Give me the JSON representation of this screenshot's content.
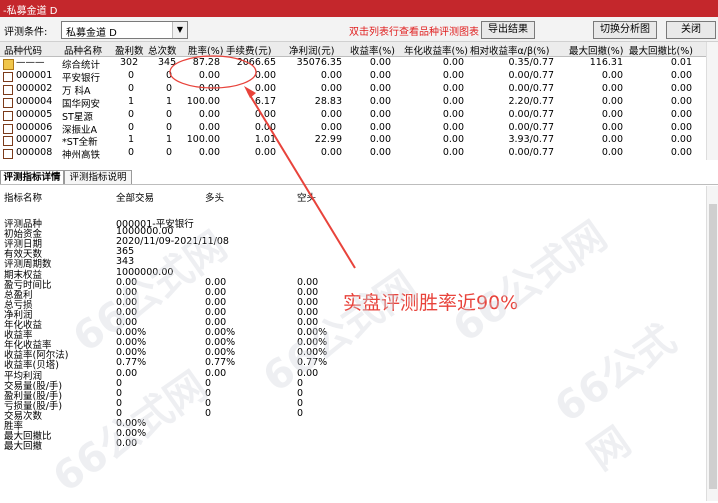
{
  "window": {
    "title": "-私募金道 D"
  },
  "toolbar": {
    "label": "评测条件:",
    "combo_value": "私募金道 D",
    "hint": "双击列表行查看品种评测图表",
    "export": "导出结果",
    "switch": "切换分析图",
    "close": "关闭"
  },
  "grid": {
    "headers": [
      "品种代码",
      "品种名称",
      "盈利数",
      "总次数",
      "胜率(%)",
      "手续费(元)",
      "净利润(元)",
      "收益率(%)",
      "年化收益率(%)",
      "相对收益率α/β(%)",
      "最大回撤(%)",
      "最大回撤比(%)"
    ],
    "rows": [
      {
        "code": "———",
        "name": "综合统计",
        "win": "302",
        "total": "345",
        "rate": "87.28",
        "fee": "2066.65",
        "net": "35076.35",
        "ret": "0.00",
        "annual": "0.00",
        "rel": "0.35/0.77",
        "dd": "116.31",
        "ddr": "0.01"
      },
      {
        "code": "000001",
        "name": "平安银行",
        "win": "0",
        "total": "0",
        "rate": "0.00",
        "fee": "0.00",
        "net": "0.00",
        "ret": "0.00",
        "annual": "0.00",
        "rel": "0.00/0.77",
        "dd": "0.00",
        "ddr": "0.00"
      },
      {
        "code": "000002",
        "name": "万 科A",
        "win": "0",
        "total": "0",
        "rate": "0.00",
        "fee": "0.00",
        "net": "0.00",
        "ret": "0.00",
        "annual": "0.00",
        "rel": "0.00/0.77",
        "dd": "0.00",
        "ddr": "0.00"
      },
      {
        "code": "000004",
        "name": "国华网安",
        "win": "1",
        "total": "1",
        "rate": "100.00",
        "fee": "6.17",
        "net": "28.83",
        "ret": "0.00",
        "annual": "0.00",
        "rel": "2.20/0.77",
        "dd": "0.00",
        "ddr": "0.00"
      },
      {
        "code": "000005",
        "name": "ST星源",
        "win": "0",
        "total": "0",
        "rate": "0.00",
        "fee": "0.00",
        "net": "0.00",
        "ret": "0.00",
        "annual": "0.00",
        "rel": "0.00/0.77",
        "dd": "0.00",
        "ddr": "0.00"
      },
      {
        "code": "000006",
        "name": "深振业A",
        "win": "0",
        "total": "0",
        "rate": "0.00",
        "fee": "0.00",
        "net": "0.00",
        "ret": "0.00",
        "annual": "0.00",
        "rel": "0.00/0.77",
        "dd": "0.00",
        "ddr": "0.00"
      },
      {
        "code": "000007",
        "name": "*ST全新",
        "win": "1",
        "total": "1",
        "rate": "100.00",
        "fee": "1.01",
        "net": "22.99",
        "ret": "0.00",
        "annual": "0.00",
        "rel": "3.93/0.77",
        "dd": "0.00",
        "ddr": "0.00"
      },
      {
        "code": "000008",
        "name": "神州高铁",
        "win": "0",
        "total": "0",
        "rate": "0.00",
        "fee": "0.00",
        "net": "0.00",
        "ret": "0.00",
        "annual": "0.00",
        "rel": "0.00/0.77",
        "dd": "0.00",
        "ddr": "0.00"
      }
    ]
  },
  "tabs": {
    "detail": "评测指标详情",
    "explain": "评测指标说明"
  },
  "detail": {
    "headers": [
      "指标名称",
      "全部交易",
      "多头",
      "空头"
    ],
    "info": [
      {
        "k": "评测品种",
        "v": "000001-平安银行"
      },
      {
        "k": "初始资金",
        "v": "1000000.00"
      },
      {
        "k": "评测日期",
        "v": "2020/11/09-2021/11/08"
      },
      {
        "k": "有效天数",
        "v": "365"
      },
      {
        "k": "评测周期数",
        "v": "343"
      },
      {
        "k": "期末权益",
        "v": "1000000.00"
      }
    ],
    "metrics": [
      {
        "k": "盈亏时间比",
        "a": "0.00",
        "b": "0.00",
        "c": "0.00"
      },
      {
        "k": "总盈利",
        "a": "0.00",
        "b": "0.00",
        "c": "0.00"
      },
      {
        "k": "总亏损",
        "a": "0.00",
        "b": "0.00",
        "c": "0.00"
      },
      {
        "k": "净利润",
        "a": "0.00",
        "b": "0.00",
        "c": "0.00"
      },
      {
        "k": "年化收益",
        "a": "0.00",
        "b": "0.00",
        "c": "0.00"
      },
      {
        "k": "收益率",
        "a": "0.00%",
        "b": "0.00%",
        "c": "0.00%"
      },
      {
        "k": "年化收益率",
        "a": "0.00%",
        "b": "0.00%",
        "c": "0.00%"
      },
      {
        "k": "收益率(阿尔法)",
        "a": "0.00%",
        "b": "0.00%",
        "c": "0.00%"
      },
      {
        "k": "收益率(贝塔)",
        "a": "0.77%",
        "b": "0.77%",
        "c": "0.77%"
      },
      {
        "k": "平均利润",
        "a": "0.00",
        "b": "0.00",
        "c": "0.00"
      },
      {
        "k": "交易量(股/手)",
        "a": "0",
        "b": "0",
        "c": "0"
      },
      {
        "k": "盈利量(股/手)",
        "a": "0",
        "b": "0",
        "c": "0"
      },
      {
        "k": "亏损量(股/手)",
        "a": "0",
        "b": "0",
        "c": "0"
      },
      {
        "k": "交易次数",
        "a": "0",
        "b": "0",
        "c": "0"
      },
      {
        "k": "胜率",
        "a": "0.00%",
        "b": "",
        "c": ""
      },
      {
        "k": "最大回撤比",
        "a": "0.00%",
        "b": "",
        "c": ""
      },
      {
        "k": "最大回撤",
        "a": "0.00",
        "b": "",
        "c": ""
      }
    ]
  },
  "annotation": {
    "text": "实盘评测胜率近90%",
    "color": "#e8433b"
  },
  "watermark": "66公式网"
}
